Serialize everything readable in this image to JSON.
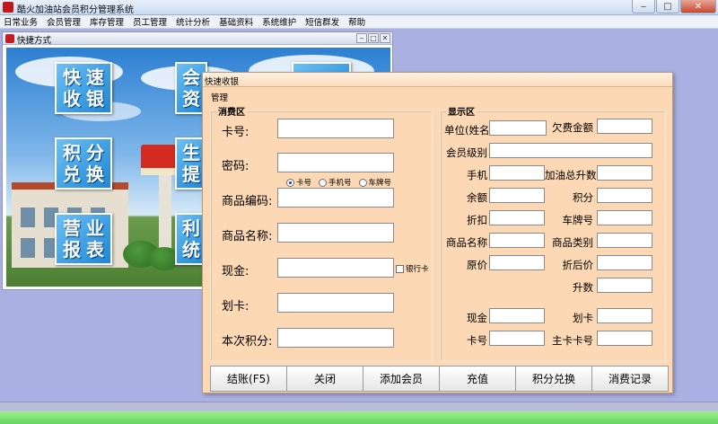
{
  "window": {
    "title": "酷火加油站会员积分管理系统",
    "min_glyph": "‒",
    "max_glyph": "□",
    "close_glyph": "✕"
  },
  "menu": [
    "日常业务",
    "会员管理",
    "库存管理",
    "员工管理",
    "统计分析",
    "基础资料",
    "系统维护",
    "短信群发",
    "帮助"
  ],
  "shortcut_window": {
    "title": "快捷方式",
    "min_glyph": "‒",
    "max_glyph": "□",
    "close_glyph": "✕",
    "tiles": [
      {
        "chars": [
          "快",
          "速",
          "收",
          "银"
        ]
      },
      {
        "chars": [
          "会",
          "资"
        ]
      },
      {
        "chars": [
          "积",
          "分",
          "兑",
          "换"
        ]
      },
      {
        "chars": [
          "生",
          "提"
        ]
      },
      {
        "chars": [
          "营",
          "业",
          "报",
          "表"
        ]
      },
      {
        "chars": [
          "利",
          "统"
        ]
      }
    ]
  },
  "dialog": {
    "title": "快速收银",
    "mgmt_label": "管理",
    "consume": {
      "title": "消费区",
      "card_no_label": "卡号:",
      "card_no_value": "",
      "radio_options": [
        {
          "label": "卡号",
          "selected": true
        },
        {
          "label": "手机号",
          "selected": false
        },
        {
          "label": "车牌号",
          "selected": false
        }
      ],
      "password_label": "密码:",
      "password_value": "",
      "goods_code_label": "商品编码:",
      "goods_code_value": "",
      "goods_name_label": "商品名称:",
      "goods_name_value": "",
      "cash_label": "现金:",
      "cash_value": "",
      "bank_card_checkbox": "银行卡",
      "swipe_label": "划卡:",
      "swipe_value": "",
      "points_label": "本次积分:",
      "points_value": ""
    },
    "display": {
      "title": "显示区",
      "unit_label": "单位(姓名)",
      "unit_value": "",
      "owed_label": "欠费金额",
      "owed_value": "",
      "level_label": "会员级别",
      "level_value": "",
      "phone_label": "手机",
      "phone_value": "",
      "fuel_total_label": "加油总升数",
      "fuel_total_value": "",
      "balance_label": "余额",
      "balance_value": "",
      "points_label": "积分",
      "points_value": "",
      "discount_label": "折扣",
      "discount_value": "",
      "plate_label": "车牌号",
      "plate_value": "",
      "goods_name_label": "商品名称",
      "goods_name_value": "",
      "goods_cat_label": "商品类别",
      "goods_cat_value": "",
      "orig_price_label": "原价",
      "orig_price_value": "",
      "disc_price_label": "折后价",
      "disc_price_value": "",
      "liters_label": "升数",
      "liters_value": "",
      "cash_label": "现金",
      "cash_value": "",
      "swipe_label": "划卡",
      "swipe_value": "",
      "card_label": "卡号",
      "card_value": "",
      "main_card_label": "主卡卡号",
      "main_card_value": ""
    },
    "buttons": {
      "checkout": "结账(F5)",
      "close": "关闭",
      "add_member": "添加会员",
      "recharge": "充值",
      "redeem": "积分兑换",
      "records": "消费记录"
    }
  },
  "colors": {
    "desktop": "#aab0e2",
    "dialog_bg": "#fcd8b4",
    "tile": "#2a8fdc",
    "status_green": "#6fdc64"
  }
}
